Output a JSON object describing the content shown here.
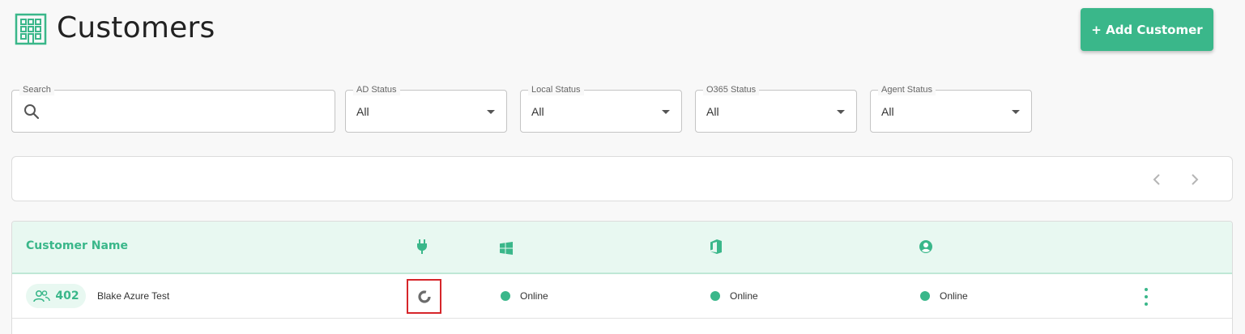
{
  "header": {
    "title": "Customers",
    "title_icon": "building-icon",
    "add_button_label": "+ Add Customer"
  },
  "filters": {
    "search": {
      "label": "Search",
      "value": "",
      "placeholder": ""
    },
    "ad_status": {
      "label": "AD Status",
      "value": "All"
    },
    "local_status": {
      "label": "Local Status",
      "value": "All"
    },
    "o365_status": {
      "label": "O365 Status",
      "value": "All"
    },
    "agent_status": {
      "label": "Agent Status",
      "value": "All"
    }
  },
  "pager": {
    "prev_icon": "chevron-left-icon",
    "next_icon": "chevron-right-icon"
  },
  "table": {
    "columns": [
      {
        "label": "Customer Name"
      },
      {
        "icon": "plug-icon"
      },
      {
        "icon": "windows-icon"
      },
      {
        "icon": "office-icon"
      },
      {
        "icon": "user-circle-icon"
      }
    ],
    "rows": [
      {
        "count": "402",
        "name": "Blake Azure Test",
        "plug_status_icon": "loading-spinner-icon",
        "windows_status": "Online",
        "office_status": "Online",
        "agent_status": "Online"
      }
    ]
  },
  "colors": {
    "accent": "#3ab78a",
    "header_bg": "#e8f8f1",
    "highlight": "#d6252a"
  }
}
